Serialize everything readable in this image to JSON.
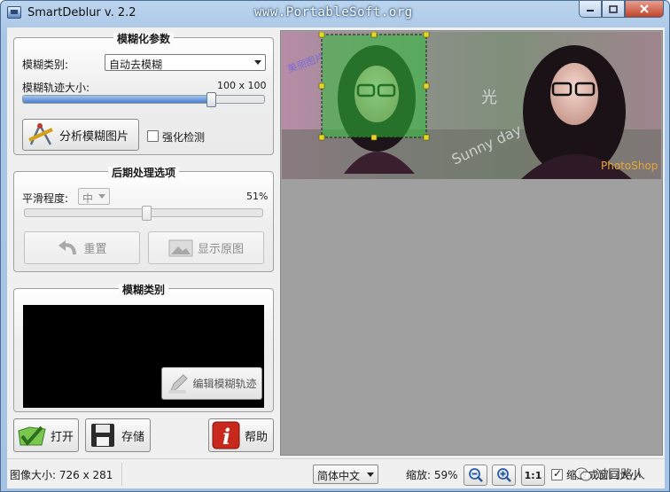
{
  "window": {
    "title": "SmartDeblur v. 2.2",
    "watermark_url": "www.PortableSoft.org"
  },
  "blur_params": {
    "title": "模糊化参数",
    "type_label": "模糊类别:",
    "type_value": "自动去模糊",
    "size_label": "模糊轨迹大小:",
    "size_readout": "100 x 100",
    "size_level": 0.78,
    "analyze_label": "分析模糊图片",
    "strengthen_label": "强化检测",
    "strengthen_checked": false
  },
  "post": {
    "title": "后期处理选项",
    "smooth_label": "平滑程度:",
    "smooth_value": "中",
    "smooth_percent": "51%",
    "smooth_level": 0.51,
    "reset_label": "重置",
    "show_original_label": "显示原图"
  },
  "blur_kind": {
    "title": "模糊类别",
    "edit_label": "编辑模糊轨迹"
  },
  "actions": {
    "open_label": "打开",
    "save_label": "存储",
    "help_label": "帮助"
  },
  "status": {
    "image_size": "图像大小: 726 x 281",
    "language": "简体中文",
    "zoom": "缩放: 59%",
    "one_to_one": "1:1",
    "fit_label": "缩放成窗口大小",
    "fit_checked": true,
    "overlay_brand": "过同路人"
  },
  "colors": {
    "selection_fill": "#2fbf3a",
    "help_red": "#c9281d",
    "open_green": "#3c9a2c"
  }
}
